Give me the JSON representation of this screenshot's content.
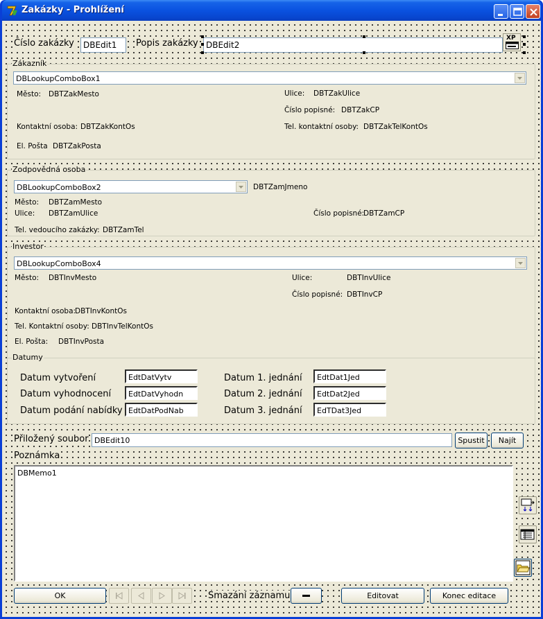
{
  "window": {
    "title": "Zakázky - Prohlížení"
  },
  "header": {
    "cislo_label": "Číslo zakázky",
    "cislo_value": "DBEdit1",
    "popis_label": "Popis zakázky",
    "popis_value": "DBEdit2",
    "xp_label": "XP"
  },
  "zakaznik": {
    "title": "Zákazník",
    "combo": "DBLookupComboBox1",
    "mesto_label": "Město:",
    "mesto_value": "DBTZakMesto",
    "ulice_label": "Ulice:",
    "ulice_value": "DBTZakUlice",
    "cp_label": "Číslo popisné:",
    "cp_value": "DBTZakCP",
    "kontakt_label": "Kontaktní osoba:",
    "kontakt_value": "DBTZakKontOs",
    "tel_label": "Tel. kontaktní osoby:",
    "tel_value": "DBTZakTelKontOs",
    "posta_label": "El. Pošta",
    "posta_value": "DBTZakPosta"
  },
  "zodpovedna": {
    "title": "Zodpovědná osoba",
    "combo": "DBLookupComboBox2",
    "jmeno_value": "DBTZamJmeno",
    "mesto_label": "Město:",
    "mesto_value": "DBTZamMesto",
    "ulice_label": "Ulice:",
    "ulice_value": "DBTZamUlice",
    "cp_label": "Číslo popisné:",
    "cp_value": "DBTZamCP",
    "tel_label": "Tel. vedoucího zakázky:",
    "tel_value": "DBTZamTel"
  },
  "investor": {
    "title": "Investor",
    "combo": "DBLookupComboBox4",
    "mesto_label": "Město:",
    "mesto_value": "DBTInvMesto",
    "ulice_label": "Ulice:",
    "ulice_value": "DBTInvUlice",
    "cp_label": "Číslo popisné:",
    "cp_value": "DBTInvCP",
    "kontakt_label": "Kontaktní osoba:",
    "kontakt_value": "DBTInvKontOs",
    "tel_label": "Tel. Kontaktní osoby:",
    "tel_value": "DBTInvTelKontOs",
    "posta_label": "El. Pošta:",
    "posta_value": "DBTInvPosta"
  },
  "datumy": {
    "title": "Datumy",
    "vytvoreni_label": "Datum vytvoření",
    "vytvoreni_value": "EdtDatVytv",
    "vyhodnoceni_label": "Datum vyhodnocení",
    "vyhodnoceni_value": "EdtDatVyhodn",
    "podani_label": "Datum podání nabídky",
    "podani_value": "EdtDatPodNab",
    "jed1_label": "Datum 1. jednání",
    "jed1_value": "EdtDat1Jed",
    "jed2_label": "Datum 2. jednání",
    "jed2_value": "EdtDat2Jed",
    "jed3_label": "Datum 3. jednání",
    "jed3_value": "EdTDat3Jed"
  },
  "soubor": {
    "label": "Přiložený soubor",
    "value": "DBEdit10",
    "spustit": "Spustit",
    "najit": "Najít"
  },
  "poznamka": {
    "label": "Poznámka",
    "memo": "DBMemo1"
  },
  "footer": {
    "ok": "OK",
    "smazani_label": "Smazání záznamu",
    "editovat": "Editovat",
    "konec": "Konec editace"
  }
}
